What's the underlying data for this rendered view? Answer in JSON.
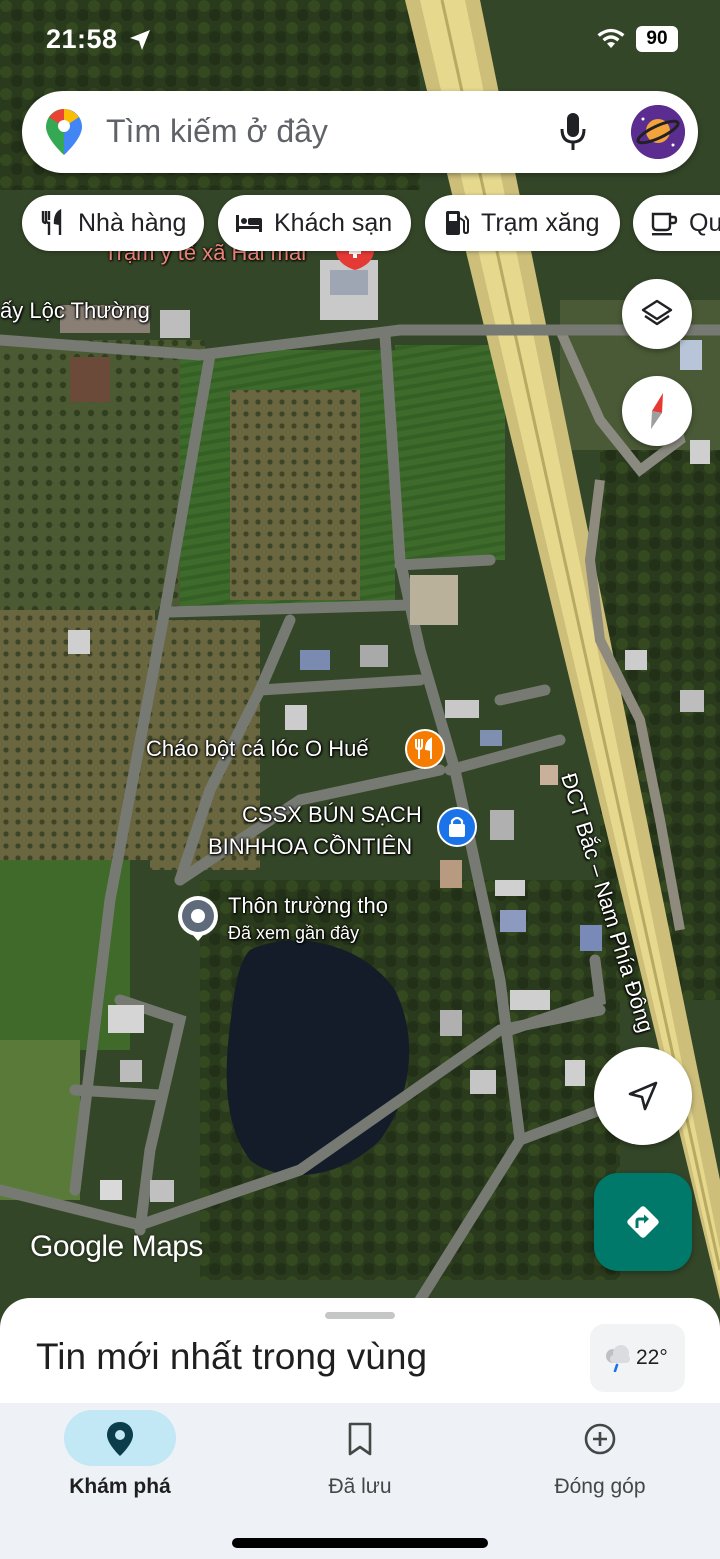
{
  "status_bar": {
    "time": "21:58",
    "battery": "90"
  },
  "search": {
    "placeholder": "Tìm kiếm ở đây"
  },
  "chips": [
    {
      "label": "Nhà hàng",
      "icon": "restaurant-icon"
    },
    {
      "label": "Khách sạn",
      "icon": "hotel-icon"
    },
    {
      "label": "Trạm xăng",
      "icon": "gas-station-icon"
    },
    {
      "label": "Qu",
      "icon": "coffee-icon"
    }
  ],
  "map": {
    "labels": {
      "health_station": "Trạm y tế xã Hải mai",
      "village": "ấy Lộc Thường",
      "restaurant": "Cháo bột cá lóc O Huế",
      "shop_line1": "CSSX BÚN SẠCH",
      "shop_line2": "BINHHOA CỒNTIÊN",
      "place_name": "Thôn trường thọ",
      "place_sub": "Đã xem gần đây",
      "highway": "ĐCT Bắc – Nam Phía Đông"
    },
    "watermark": "Google Maps"
  },
  "sheet": {
    "title": "Tin mới nhất trong vùng",
    "temperature": "22°"
  },
  "nav": [
    {
      "label": "Khám phá",
      "icon": "explore-pin-icon",
      "active": true
    },
    {
      "label": "Đã lưu",
      "icon": "bookmark-icon",
      "active": false
    },
    {
      "label": "Đóng góp",
      "icon": "add-circle-icon",
      "active": false
    }
  ],
  "colors": {
    "accent_teal": "#00796b",
    "active_pill": "#c2e7f5",
    "restaurant_pin": "#f57c00",
    "shop_pin": "#1a73e8"
  }
}
